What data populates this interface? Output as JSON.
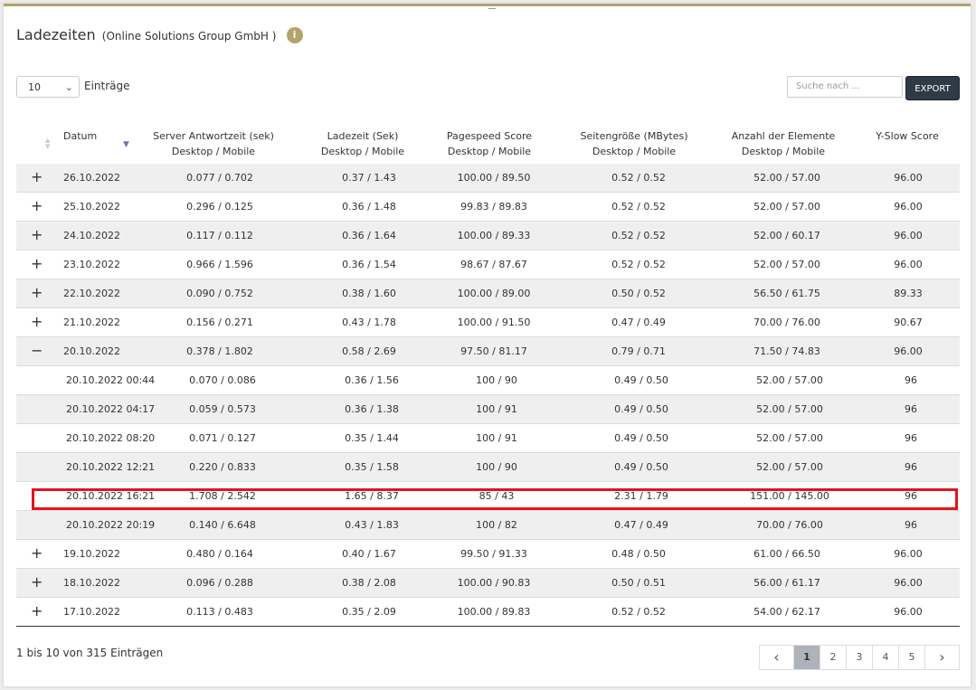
{
  "header": {
    "title": "Ladezeiten",
    "subtitle": "(Online Solutions Group GmbH )",
    "info_icon": "info-icon"
  },
  "controls": {
    "length_value": "10",
    "length_label": "Einträge",
    "search_placeholder": "Suche nach ...",
    "export_label": "EXPORT"
  },
  "columns": [
    {
      "line1": "Datum",
      "line2": ""
    },
    {
      "line1": "Server Antwortzeit (sek)",
      "line2": "Desktop / Mobile"
    },
    {
      "line1": "Ladezeit (Sek)",
      "line2": "Desktop / Mobile"
    },
    {
      "line1": "Pagespeed Score",
      "line2": "Desktop / Mobile"
    },
    {
      "line1": "Seitengröße (MBytes)",
      "line2": "Desktop / Mobile"
    },
    {
      "line1": "Anzahl der Elemente",
      "line2": "Desktop / Mobile"
    },
    {
      "line1": "Y-Slow Score",
      "line2": ""
    }
  ],
  "rows": [
    {
      "toggle": "+",
      "date": "26.10.2022",
      "server": "0.077 / 0.702",
      "load": "0.37 / 1.43",
      "pagespeed": "100.00 / 89.50",
      "size": "0.52 / 0.52",
      "elements": "52.00 / 57.00",
      "yslow": "96.00"
    },
    {
      "toggle": "+",
      "date": "25.10.2022",
      "server": "0.296 / 0.125",
      "load": "0.36 / 1.48",
      "pagespeed": "99.83 / 89.83",
      "size": "0.52 / 0.52",
      "elements": "52.00 / 57.00",
      "yslow": "96.00"
    },
    {
      "toggle": "+",
      "date": "24.10.2022",
      "server": "0.117 / 0.112",
      "load": "0.36 / 1.64",
      "pagespeed": "100.00 / 89.33",
      "size": "0.52 / 0.52",
      "elements": "52.00 / 60.17",
      "yslow": "96.00"
    },
    {
      "toggle": "+",
      "date": "23.10.2022",
      "server": "0.966 / 1.596",
      "load": "0.36 / 1.54",
      "pagespeed": "98.67 / 87.67",
      "size": "0.52 / 0.52",
      "elements": "52.00 / 57.00",
      "yslow": "96.00"
    },
    {
      "toggle": "+",
      "date": "22.10.2022",
      "server": "0.090 / 0.752",
      "load": "0.38 / 1.60",
      "pagespeed": "100.00 / 89.00",
      "size": "0.50 / 0.52",
      "elements": "56.50 / 61.75",
      "yslow": "89.33"
    },
    {
      "toggle": "+",
      "date": "21.10.2022",
      "server": "0.156 / 0.271",
      "load": "0.43 / 1.78",
      "pagespeed": "100.00 / 91.50",
      "size": "0.47 / 0.49",
      "elements": "70.00 / 76.00",
      "yslow": "90.67"
    },
    {
      "toggle": "−",
      "date": "20.10.2022",
      "server": "0.378 / 1.802",
      "load": "0.58 / 2.69",
      "pagespeed": "97.50 / 81.17",
      "size": "0.79 / 0.71",
      "elements": "71.50 / 74.83",
      "yslow": "96.00"
    },
    {
      "toggle": "",
      "date": "20.10.2022 00:44",
      "server": "0.070 / 0.086",
      "load": "0.36 / 1.56",
      "pagespeed": "100 / 90",
      "size": "0.49 / 0.50",
      "elements": "52.00 / 57.00",
      "yslow": "96"
    },
    {
      "toggle": "",
      "date": "20.10.2022 04:17",
      "server": "0.059 / 0.573",
      "load": "0.36 / 1.38",
      "pagespeed": "100 / 91",
      "size": "0.49 / 0.50",
      "elements": "52.00 / 57.00",
      "yslow": "96"
    },
    {
      "toggle": "",
      "date": "20.10.2022 08:20",
      "server": "0.071 / 0.127",
      "load": "0.35 / 1.44",
      "pagespeed": "100 / 91",
      "size": "0.49 / 0.50",
      "elements": "52.00 / 57.00",
      "yslow": "96"
    },
    {
      "toggle": "",
      "date": "20.10.2022 12:21",
      "server": "0.220 / 0.833",
      "load": "0.35 / 1.58",
      "pagespeed": "100 / 90",
      "size": "0.49 / 0.50",
      "elements": "52.00 / 57.00",
      "yslow": "96"
    },
    {
      "toggle": "",
      "date": "20.10.2022 16:21",
      "server": "1.708 / 2.542",
      "load": "1.65 / 8.37",
      "pagespeed": "85 / 43",
      "size": "2.31 / 1.79",
      "elements": "151.00 / 145.00",
      "yslow": "96"
    },
    {
      "toggle": "",
      "date": "20.10.2022 20:19",
      "server": "0.140 / 6.648",
      "load": "0.43 / 1.83",
      "pagespeed": "100 / 82",
      "size": "0.47 / 0.49",
      "elements": "70.00 / 76.00",
      "yslow": "96"
    },
    {
      "toggle": "+",
      "date": "19.10.2022",
      "server": "0.480 / 0.164",
      "load": "0.40 / 1.67",
      "pagespeed": "99.50 / 91.33",
      "size": "0.48 / 0.50",
      "elements": "61.00 / 66.50",
      "yslow": "96.00"
    },
    {
      "toggle": "+",
      "date": "18.10.2022",
      "server": "0.096 / 0.288",
      "load": "0.38 / 2.08",
      "pagespeed": "100.00 / 90.83",
      "size": "0.50 / 0.51",
      "elements": "56.00 / 61.17",
      "yslow": "96.00"
    },
    {
      "toggle": "+",
      "date": "17.10.2022",
      "server": "0.113 / 0.483",
      "load": "0.35 / 2.09",
      "pagespeed": "100.00 / 89.83",
      "size": "0.52 / 0.52",
      "elements": "54.00 / 62.17",
      "yslow": "96.00"
    }
  ],
  "footer": {
    "info": "1 bis 10 von 315 Einträgen",
    "pages": [
      "1",
      "2",
      "3",
      "4",
      "5"
    ],
    "prev": "‹",
    "next": "›"
  },
  "colors": {
    "accent": "#b4a46b",
    "export_bg": "#2e3a46",
    "highlight": "#e3141c"
  }
}
